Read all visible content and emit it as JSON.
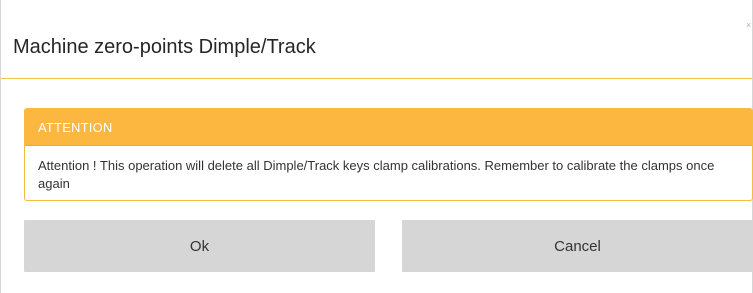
{
  "dialog": {
    "title": "Machine zero-points Dimple/Track",
    "close_glyph": "×"
  },
  "alert": {
    "heading": "ATTENTION",
    "message": "Attention ! This operation will delete all Dimple/Track keys clamp calibrations. Remember to calibrate the clamps once again"
  },
  "buttons": {
    "ok_label": "Ok",
    "cancel_label": "Cancel"
  },
  "colors": {
    "accent": "#fbb73f",
    "button_bg": "#d6d6d6"
  }
}
